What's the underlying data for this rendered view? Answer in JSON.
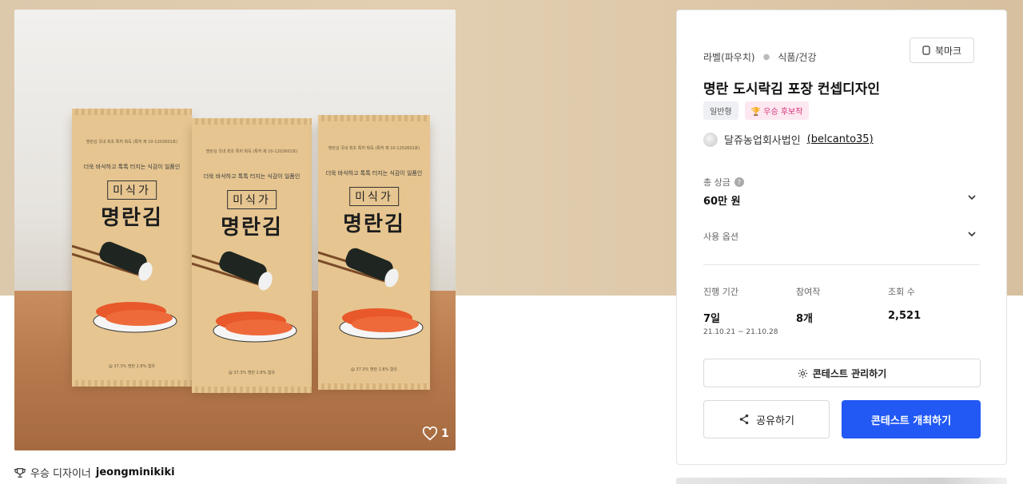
{
  "product": {
    "package_fine_print": "명란김 국내 최초 특허 획득 (특허 제 10-1202601호)",
    "package_tagline": "더욱 바삭하고 톡톡 터지는 식감이 일품인",
    "package_brand": "미식가",
    "package_name": "명란김",
    "package_bottom": "@ 37.3% 명란 2.8% 함유",
    "like_count": "1"
  },
  "winner": {
    "prefix": "우승 디자이너",
    "name": "jeongminikiki"
  },
  "panel": {
    "category_main": "라벨(파우치)",
    "category_sub": "식품/건강",
    "bookmark_label": "북마크",
    "title": "명란 도시락김 포장 컨셉디자인",
    "badge_type": "일반형",
    "badge_candidate": "우승 후보작",
    "host_name": "달쥬농업회사법인",
    "host_id": "(belcanto35)",
    "prize_label": "총 상금",
    "prize_value": "60만 원",
    "usage_label": "사용 옵션",
    "stats": [
      {
        "label": "진행 기간",
        "value": "7일",
        "sub": "21.10.21 ~ 21.10.28"
      },
      {
        "label": "참여작",
        "value": "8개",
        "sub": ""
      },
      {
        "label": "조회 수",
        "value": "2,521",
        "sub": ""
      }
    ],
    "manage_label": "콘테스트 관리하기",
    "share_label": "공유하기",
    "host_contest_label": "콘테스트 개최하기"
  },
  "colors": {
    "primary": "#2259f5",
    "hero_bg": "#dcc8ab",
    "candidate_badge": "#d6337a"
  },
  "icons": [
    "heart-icon",
    "trophy-icon",
    "bookmark-icon",
    "question-icon",
    "chevron-down-icon",
    "gear-icon",
    "share-icon"
  ]
}
